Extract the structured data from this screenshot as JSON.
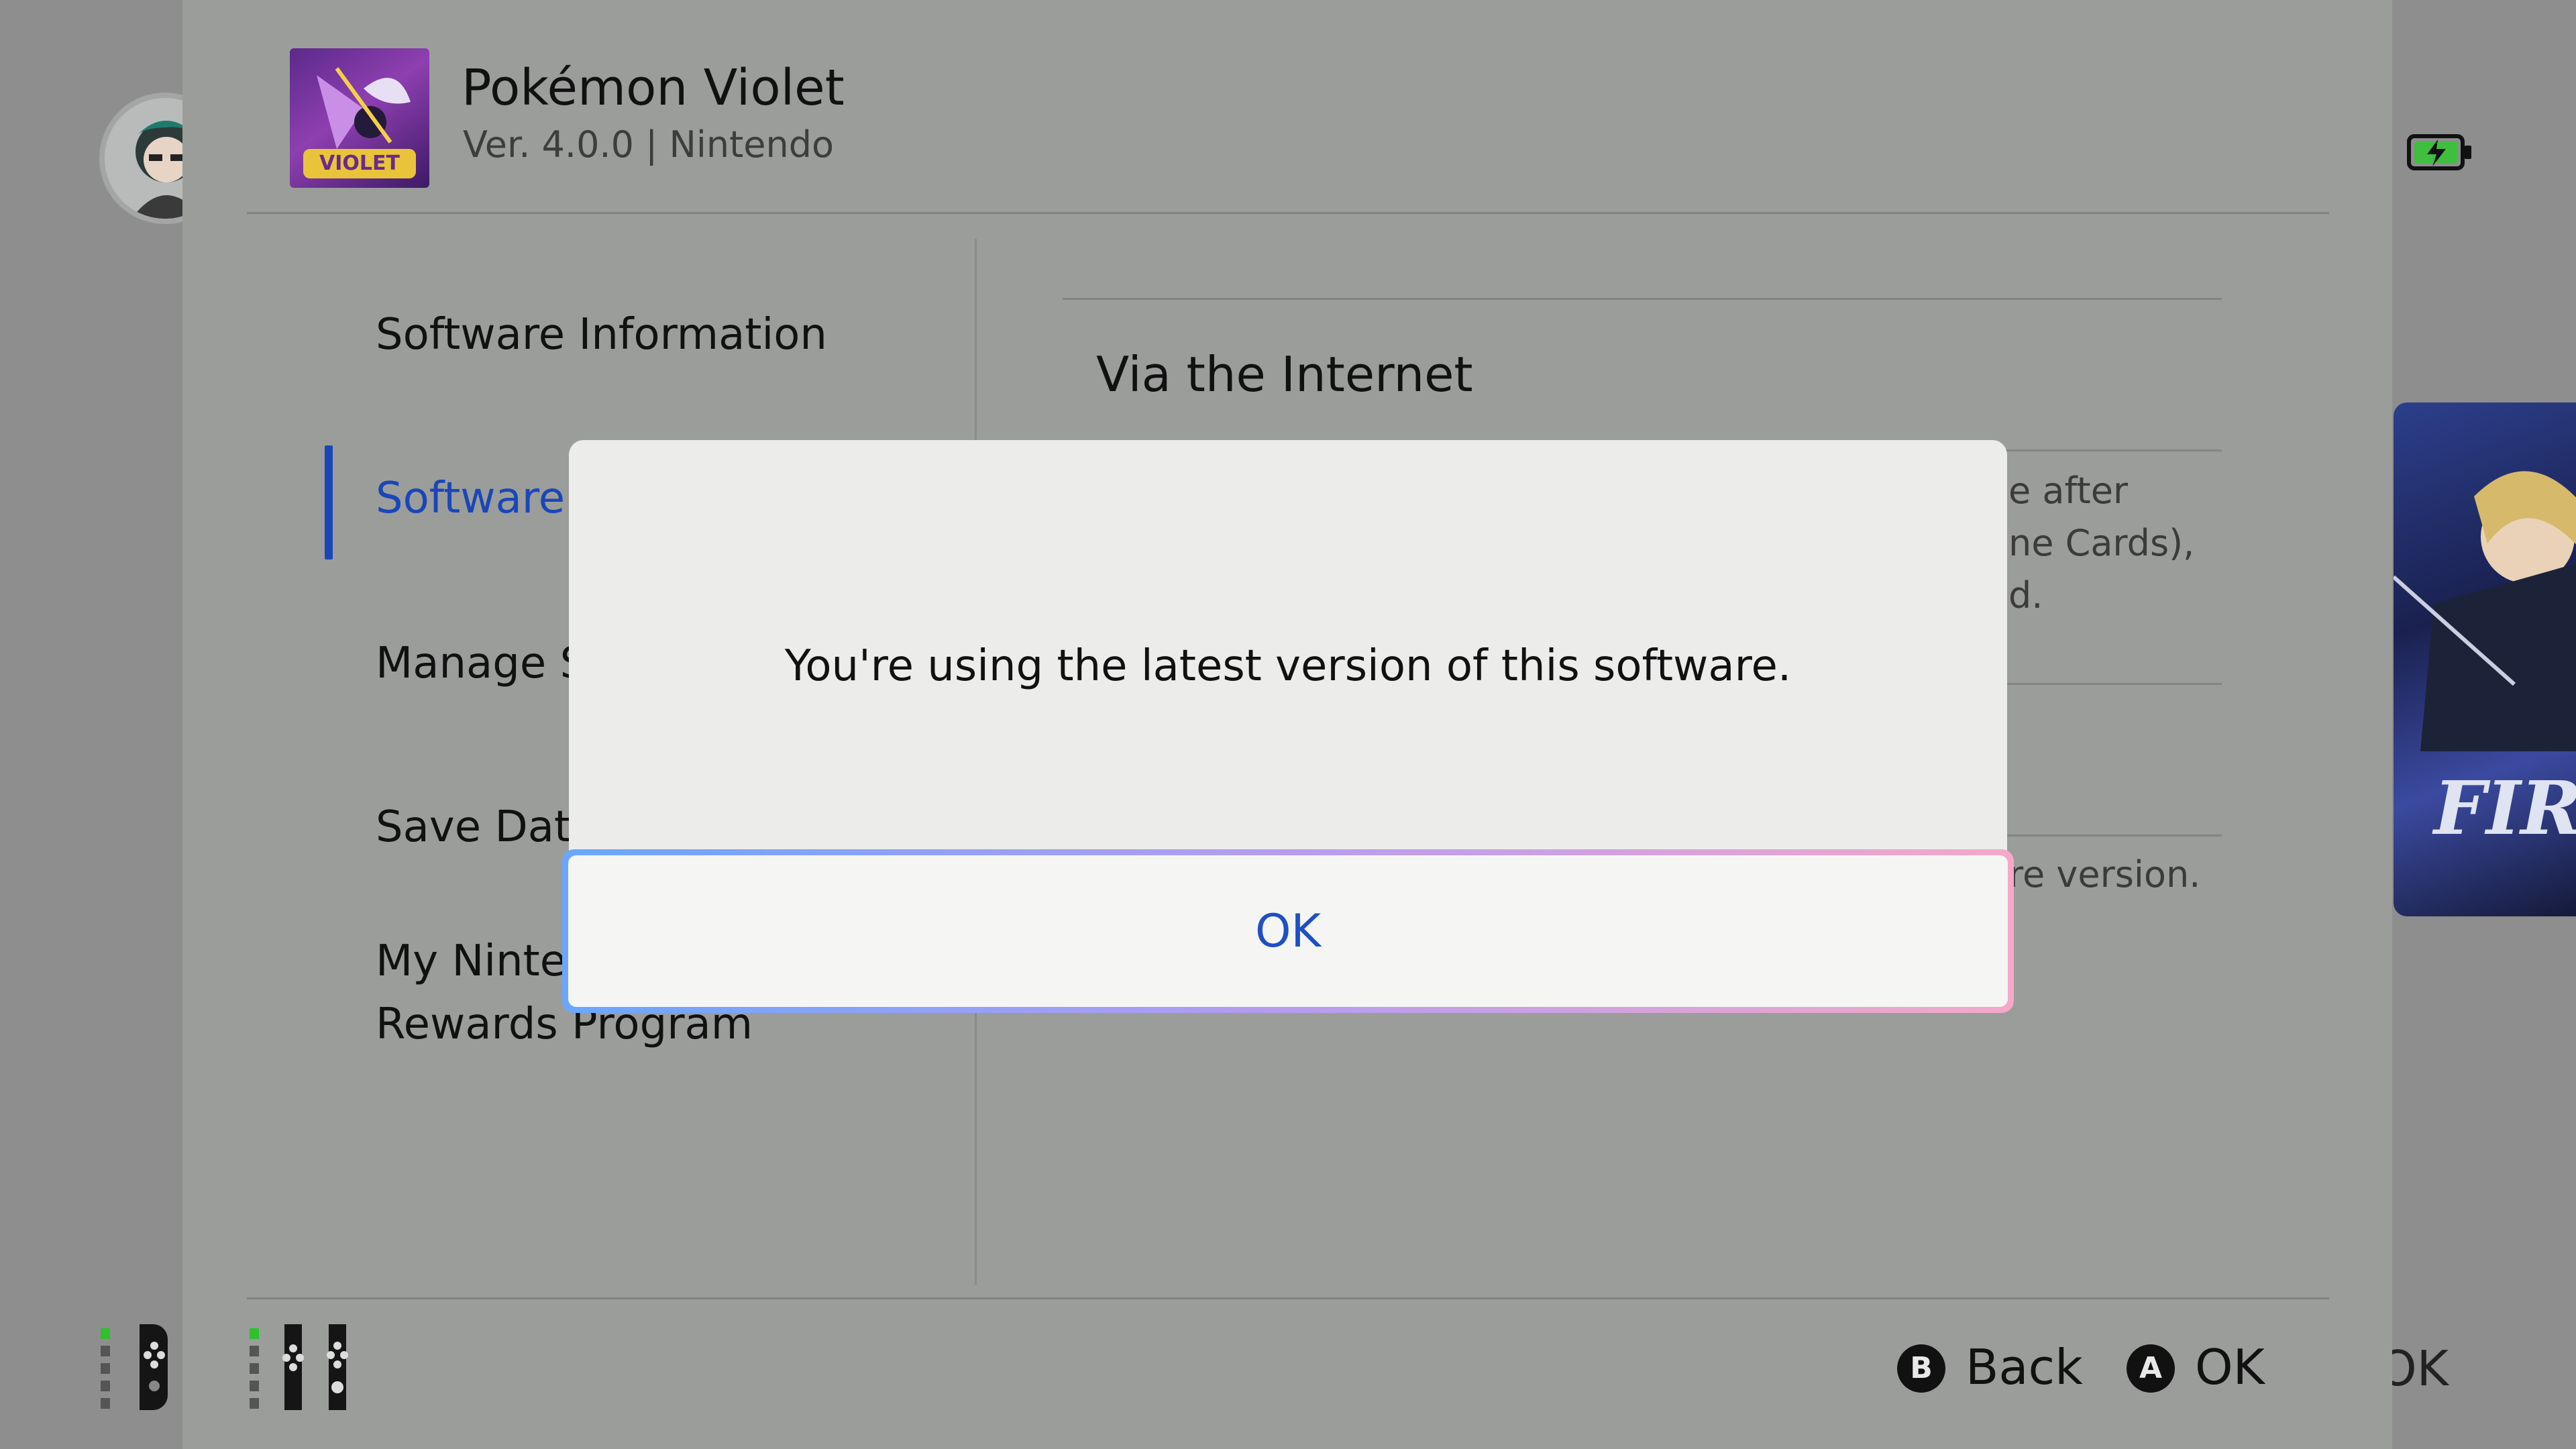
{
  "header": {
    "game_title": "Pokémon Violet",
    "game_meta": "Ver. 4.0.0  |  Nintendo",
    "game_icon_text": "VIOLET"
  },
  "nav": {
    "items": [
      {
        "label": "Software Information"
      },
      {
        "label": "Software U"
      },
      {
        "label": "Manage S"
      },
      {
        "label": "Save Data"
      },
      {
        "label": "My Ninte"
      },
      {
        "label": "Rewards Program"
      }
    ],
    "active_index": 1
  },
  "content": {
    "via_internet": "Via the Internet",
    "fragments": [
      "e after",
      "ne Cards),",
      "d.",
      "re version."
    ]
  },
  "dialog": {
    "message": "You're using the latest version of this software.",
    "ok_label": "OK"
  },
  "footer": {
    "back_button_glyph": "B",
    "back_label": "Back",
    "ok_button_glyph": "A",
    "ok_label": "OK"
  },
  "background": {
    "right_ok_fragment": "OK",
    "game_tile_text": "FIRE"
  },
  "colors": {
    "accent": "#1a46b8",
    "ok_text": "#1f4fc4",
    "battery_green": "#3fbf3f"
  }
}
